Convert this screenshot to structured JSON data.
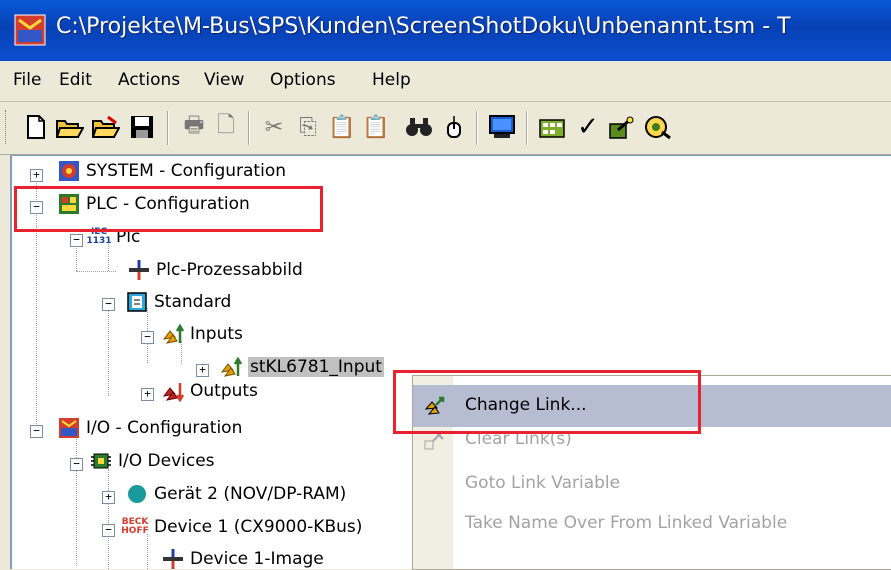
{
  "window": {
    "title": "C:\\Projekte\\M-Bus\\SPS\\Kunden\\ScreenShotDoku\\Unbenannt.tsm - T"
  },
  "menu": [
    "File",
    "Edit",
    "Actions",
    "View",
    "Options",
    "Help"
  ],
  "toolbar": {
    "icons": [
      "new-icon",
      "open-icon",
      "open-remote-icon",
      "save-icon",
      "print-icon",
      "print-preview-icon",
      "cut-icon",
      "copy-icon",
      "paste-icon",
      "paste-with-links-icon",
      "find-icon",
      "find-next-icon",
      "display-icon",
      "config-mode-icon",
      "check-icon",
      "activate-icon",
      "restart-icon"
    ]
  },
  "tree": {
    "system": "SYSTEM - Configuration",
    "plc": "PLC - Configuration",
    "plc_project": "Plc",
    "plc_project_icon_text": "IEC 1131",
    "process_image": "Plc-Prozessabbild",
    "standard": "Standard",
    "inputs": "Inputs",
    "input_var": "stKL6781_Input",
    "outputs": "Outputs",
    "io": "I/O - Configuration",
    "io_devices": "I/O Devices",
    "device2": "Gerät 2 (NOV/DP-RAM)",
    "device1": "Device 1 (CX9000-KBus)",
    "device1_icon_text": "BECK HOFF",
    "device1_image": "Device 1-Image"
  },
  "context_menu": {
    "items": [
      {
        "label": "Change Link...",
        "enabled": true
      },
      {
        "label": "Clear Link(s)",
        "enabled": false
      },
      {
        "label": "Goto Link Variable",
        "enabled": false
      },
      {
        "label": "Take Name Over From Linked Variable",
        "enabled": false
      }
    ]
  },
  "colors": {
    "titlebar": "#0a4fd0",
    "highlight": "#e8232f",
    "menu_hover": "#b6bdd2",
    "disabled_text": "#a3a3a3"
  }
}
